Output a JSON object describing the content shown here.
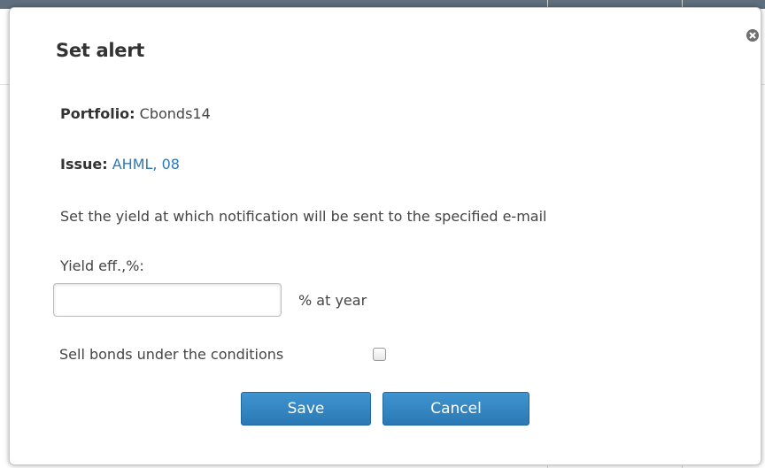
{
  "dialog": {
    "title": "Set alert"
  },
  "portfolio": {
    "label": "Portfolio:",
    "value": "Cbonds14"
  },
  "issue": {
    "label": "Issue:",
    "value": "AHML, 08"
  },
  "instruction": "Set the yield at which notification will be sent to the specified e-mail",
  "yield": {
    "label": "Yield eff.,%:",
    "value": "",
    "unit": "% at year"
  },
  "sell_option": {
    "label": "Sell bonds under the conditions",
    "checked": false
  },
  "buttons": {
    "save": "Save",
    "cancel": "Cancel"
  },
  "colors": {
    "accent": "#2f78b7",
    "button": "#2a78b4"
  },
  "icons": {
    "close": "close-icon"
  }
}
